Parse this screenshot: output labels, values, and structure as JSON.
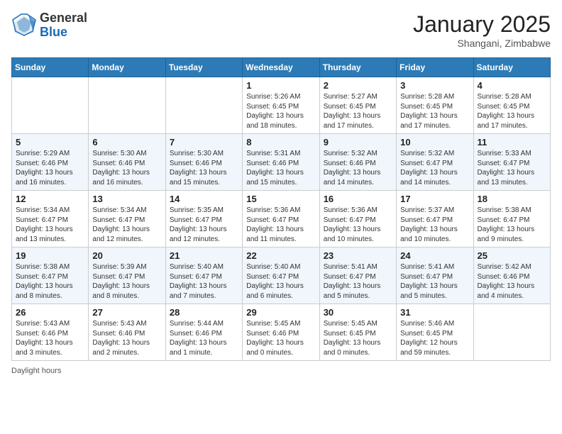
{
  "logo": {
    "general": "General",
    "blue": "Blue"
  },
  "title": "January 2025",
  "location": "Shangani, Zimbabwe",
  "days_header": [
    "Sunday",
    "Monday",
    "Tuesday",
    "Wednesday",
    "Thursday",
    "Friday",
    "Saturday"
  ],
  "weeks": [
    [
      {
        "num": "",
        "text": ""
      },
      {
        "num": "",
        "text": ""
      },
      {
        "num": "",
        "text": ""
      },
      {
        "num": "1",
        "text": "Sunrise: 5:26 AM\nSunset: 6:45 PM\nDaylight: 13 hours and 18 minutes."
      },
      {
        "num": "2",
        "text": "Sunrise: 5:27 AM\nSunset: 6:45 PM\nDaylight: 13 hours and 17 minutes."
      },
      {
        "num": "3",
        "text": "Sunrise: 5:28 AM\nSunset: 6:45 PM\nDaylight: 13 hours and 17 minutes."
      },
      {
        "num": "4",
        "text": "Sunrise: 5:28 AM\nSunset: 6:45 PM\nDaylight: 13 hours and 17 minutes."
      }
    ],
    [
      {
        "num": "5",
        "text": "Sunrise: 5:29 AM\nSunset: 6:46 PM\nDaylight: 13 hours and 16 minutes."
      },
      {
        "num": "6",
        "text": "Sunrise: 5:30 AM\nSunset: 6:46 PM\nDaylight: 13 hours and 16 minutes."
      },
      {
        "num": "7",
        "text": "Sunrise: 5:30 AM\nSunset: 6:46 PM\nDaylight: 13 hours and 15 minutes."
      },
      {
        "num": "8",
        "text": "Sunrise: 5:31 AM\nSunset: 6:46 PM\nDaylight: 13 hours and 15 minutes."
      },
      {
        "num": "9",
        "text": "Sunrise: 5:32 AM\nSunset: 6:46 PM\nDaylight: 13 hours and 14 minutes."
      },
      {
        "num": "10",
        "text": "Sunrise: 5:32 AM\nSunset: 6:47 PM\nDaylight: 13 hours and 14 minutes."
      },
      {
        "num": "11",
        "text": "Sunrise: 5:33 AM\nSunset: 6:47 PM\nDaylight: 13 hours and 13 minutes."
      }
    ],
    [
      {
        "num": "12",
        "text": "Sunrise: 5:34 AM\nSunset: 6:47 PM\nDaylight: 13 hours and 13 minutes."
      },
      {
        "num": "13",
        "text": "Sunrise: 5:34 AM\nSunset: 6:47 PM\nDaylight: 13 hours and 12 minutes."
      },
      {
        "num": "14",
        "text": "Sunrise: 5:35 AM\nSunset: 6:47 PM\nDaylight: 13 hours and 12 minutes."
      },
      {
        "num": "15",
        "text": "Sunrise: 5:36 AM\nSunset: 6:47 PM\nDaylight: 13 hours and 11 minutes."
      },
      {
        "num": "16",
        "text": "Sunrise: 5:36 AM\nSunset: 6:47 PM\nDaylight: 13 hours and 10 minutes."
      },
      {
        "num": "17",
        "text": "Sunrise: 5:37 AM\nSunset: 6:47 PM\nDaylight: 13 hours and 10 minutes."
      },
      {
        "num": "18",
        "text": "Sunrise: 5:38 AM\nSunset: 6:47 PM\nDaylight: 13 hours and 9 minutes."
      }
    ],
    [
      {
        "num": "19",
        "text": "Sunrise: 5:38 AM\nSunset: 6:47 PM\nDaylight: 13 hours and 8 minutes."
      },
      {
        "num": "20",
        "text": "Sunrise: 5:39 AM\nSunset: 6:47 PM\nDaylight: 13 hours and 8 minutes."
      },
      {
        "num": "21",
        "text": "Sunrise: 5:40 AM\nSunset: 6:47 PM\nDaylight: 13 hours and 7 minutes."
      },
      {
        "num": "22",
        "text": "Sunrise: 5:40 AM\nSunset: 6:47 PM\nDaylight: 13 hours and 6 minutes."
      },
      {
        "num": "23",
        "text": "Sunrise: 5:41 AM\nSunset: 6:47 PM\nDaylight: 13 hours and 5 minutes."
      },
      {
        "num": "24",
        "text": "Sunrise: 5:41 AM\nSunset: 6:47 PM\nDaylight: 13 hours and 5 minutes."
      },
      {
        "num": "25",
        "text": "Sunrise: 5:42 AM\nSunset: 6:46 PM\nDaylight: 13 hours and 4 minutes."
      }
    ],
    [
      {
        "num": "26",
        "text": "Sunrise: 5:43 AM\nSunset: 6:46 PM\nDaylight: 13 hours and 3 minutes."
      },
      {
        "num": "27",
        "text": "Sunrise: 5:43 AM\nSunset: 6:46 PM\nDaylight: 13 hours and 2 minutes."
      },
      {
        "num": "28",
        "text": "Sunrise: 5:44 AM\nSunset: 6:46 PM\nDaylight: 13 hours and 1 minute."
      },
      {
        "num": "29",
        "text": "Sunrise: 5:45 AM\nSunset: 6:46 PM\nDaylight: 13 hours and 0 minutes."
      },
      {
        "num": "30",
        "text": "Sunrise: 5:45 AM\nSunset: 6:45 PM\nDaylight: 13 hours and 0 minutes."
      },
      {
        "num": "31",
        "text": "Sunrise: 5:46 AM\nSunset: 6:45 PM\nDaylight: 12 hours and 59 minutes."
      },
      {
        "num": "",
        "text": ""
      }
    ]
  ],
  "footer": "Daylight hours"
}
